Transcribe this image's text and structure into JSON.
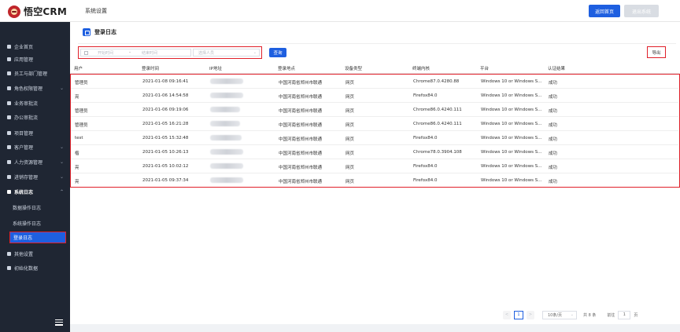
{
  "app": {
    "title": "悟空CRM",
    "section": "系统设置"
  },
  "header": {
    "home_label": "返回首页",
    "logout_label": "退出系统"
  },
  "sidebar": {
    "items": [
      {
        "label": "企业首页",
        "icon": "home-icon"
      },
      {
        "label": "应用管理",
        "icon": "grid-icon"
      },
      {
        "label": "员工与部门管理",
        "icon": "org-icon"
      },
      {
        "label": "角色权限管理",
        "icon": "user-icon"
      },
      {
        "label": "业务审批流",
        "icon": "user-icon"
      },
      {
        "label": "办公审批流",
        "icon": "user-icon"
      },
      {
        "label": "项目管理",
        "icon": "list-icon"
      },
      {
        "label": "客户管理",
        "icon": "chart-icon"
      },
      {
        "label": "人力资源管理",
        "icon": "user-icon"
      },
      {
        "label": "进销存管理",
        "icon": "box-icon"
      },
      {
        "label": "系统日志",
        "icon": "doc-icon"
      },
      {
        "label": "其他设置",
        "icon": "gear-icon"
      },
      {
        "label": "初始化数据",
        "icon": "data-icon"
      }
    ],
    "sub_items": [
      "数据操作日志",
      "系统操作日志",
      "登录日志"
    ]
  },
  "page": {
    "title": "登录日志",
    "start_placeholder": "开始时间",
    "range_sep": "-",
    "end_placeholder": "结束时间",
    "user_placeholder": "选择人员",
    "query_label": "查询",
    "export_label": "导出"
  },
  "table": {
    "columns": [
      "用户",
      "登录时间",
      "IP地址",
      "登录地点",
      "设备类型",
      "终端内核",
      "平台",
      "认证结果"
    ],
    "rows": [
      [
        "管理员",
        "2021-01-08 09:16:41",
        "",
        "中国河南省郑州市联通",
        "网页",
        "Chrome87.0.4280.88",
        "Windows 10 or Windows S...",
        "成功"
      ],
      [
        "亮",
        "2021-01-06 14:54:58",
        "",
        "中国河南省郑州市联通",
        "网页",
        "Firefox84.0",
        "Windows 10 or Windows S...",
        "成功"
      ],
      [
        "管理员",
        "2021-01-06 09:19:06",
        "",
        "中国河南省郑州市联通",
        "网页",
        "Chrome86.0.4240.111",
        "Windows 10 or Windows S...",
        "成功"
      ],
      [
        "管理员",
        "2021-01-05 16:21:28",
        "",
        "中国河南省郑州市联通",
        "网页",
        "Chrome86.0.4240.111",
        "Windows 10 or Windows S...",
        "成功"
      ],
      [
        "test",
        "2021-01-05 15:32:48",
        "",
        "中国河南省郑州市联通",
        "网页",
        "Firefox84.0",
        "Windows 10 or Windows S...",
        "成功"
      ],
      [
        "楷",
        "2021-01-05 10:26:13",
        "",
        "中国河南省郑州市联通",
        "网页",
        "Chrome78.0.3904.108",
        "Windows 10 or Windows S...",
        "成功"
      ],
      [
        "亮",
        "2021-01-05 10:02:12",
        "",
        "中国河南省郑州市联通",
        "网页",
        "Firefox84.0",
        "Windows 10 or Windows S...",
        "成功"
      ],
      [
        "亮",
        "2021-01-05 09:37:34",
        "",
        "中国河南省郑州市联通",
        "网页",
        "Firefox84.0",
        "Windows 10 or Windows S...",
        "成功"
      ]
    ]
  },
  "pagination": {
    "prev": "<",
    "current_page": "1",
    "next": ">",
    "page_size": "10条/页",
    "total": "共 8 条",
    "goto_label": "前往",
    "goto_value": "1",
    "page_unit": "页"
  }
}
